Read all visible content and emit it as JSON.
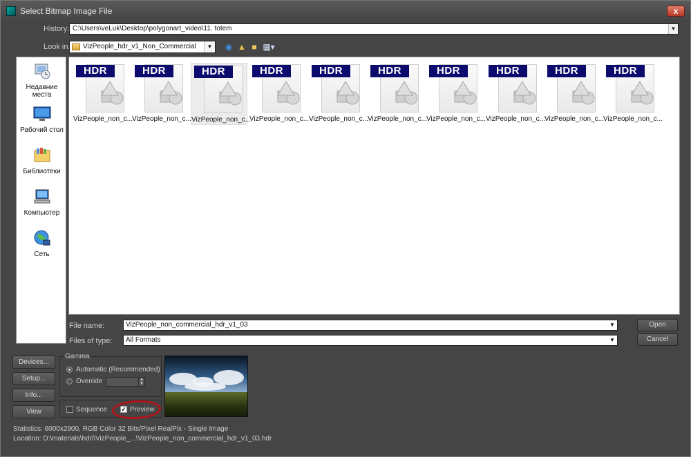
{
  "window": {
    "title": "Select Bitmap Image File",
    "close_glyph": "x"
  },
  "history": {
    "label": "History:",
    "value": "C:\\Users\\veLuk\\Desktop\\polygonart_video\\11. totem"
  },
  "look_in": {
    "label": "Look in:",
    "value": "VizPeople_hdr_v1_Non_Commercial"
  },
  "places": [
    {
      "line1": "Недавние",
      "line2": "места",
      "icon": "recent-places-icon"
    },
    {
      "line1": "Рабочий стол",
      "line2": "",
      "icon": "desktop-icon"
    },
    {
      "line1": "Библиотеки",
      "line2": "",
      "icon": "libraries-icon"
    },
    {
      "line1": "Компьютер",
      "line2": "",
      "icon": "computer-icon"
    },
    {
      "line1": "Сеть",
      "line2": "",
      "icon": "network-icon"
    }
  ],
  "files": [
    {
      "badge": "HDR",
      "name": "VizPeople_non_c...",
      "selected": false
    },
    {
      "badge": "HDR",
      "name": "VizPeople_non_c...",
      "selected": false
    },
    {
      "badge": "HDR",
      "name": "VizPeople_non_c...",
      "selected": true
    },
    {
      "badge": "HDR",
      "name": "VizPeople_non_c...",
      "selected": false
    },
    {
      "badge": "HDR",
      "name": "VizPeople_non_c...",
      "selected": false
    },
    {
      "badge": "HDR",
      "name": "VizPeople_non_c...",
      "selected": false
    },
    {
      "badge": "HDR",
      "name": "VizPeople_non_c...",
      "selected": false
    },
    {
      "badge": "HDR",
      "name": "VizPeople_non_c...",
      "selected": false
    },
    {
      "badge": "HDR",
      "name": "VizPeople_non_c...",
      "selected": false
    },
    {
      "badge": "HDR",
      "name": "VizPeople_non_c...",
      "selected": false
    }
  ],
  "file_name": {
    "label": "File name:",
    "value": "VizPeople_non_commercial_hdr_v1_03"
  },
  "files_of_type": {
    "label": "Files of type:",
    "value": "All Formats"
  },
  "buttons": {
    "open": "Open",
    "cancel": "Cancel",
    "devices": "Devices...",
    "setup": "Setup...",
    "info": "Info...",
    "view": "View"
  },
  "gamma": {
    "title": "Gamma",
    "automatic": "Automatic (Recommended)",
    "override": "Override",
    "selected": "automatic"
  },
  "options": {
    "sequence": "Sequence",
    "preview": "Preview",
    "sequence_checked": false,
    "preview_checked": true
  },
  "status": {
    "statistics": "Statistics:  6000x2900, RGB Color 32 Bits/Pixel RealPix - Single Image",
    "location": "Location:  D:\\materials\\hdri\\VizPeople_...\\VizPeople_non_commercial_hdr_v1_03.hdr"
  },
  "colors": {
    "hdr_badge": "#0b0b6e",
    "annotation_circle": "#b2141a",
    "dialog_bg": "#454545"
  }
}
